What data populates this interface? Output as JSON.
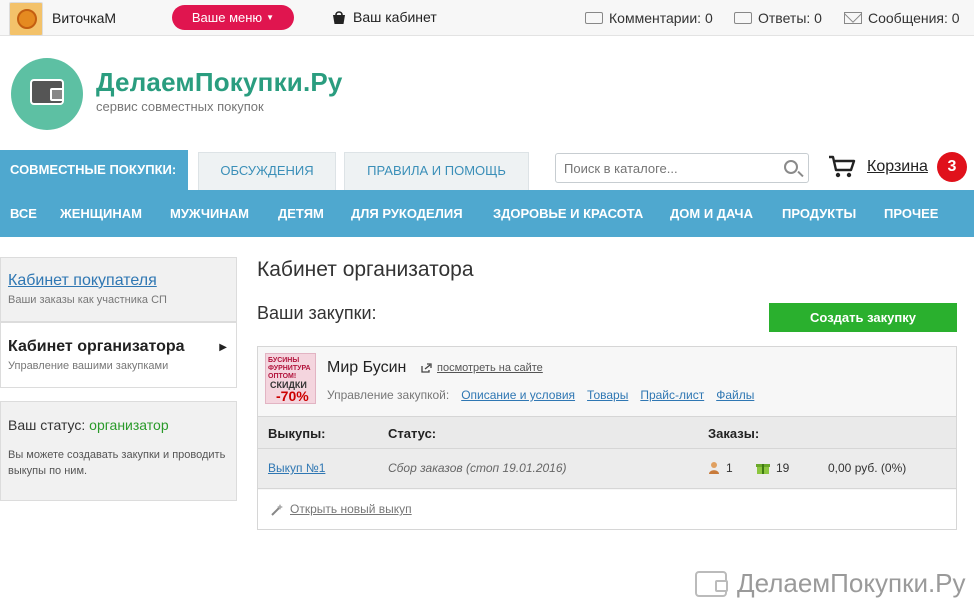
{
  "topbar": {
    "username": "ВиточкаМ",
    "menu_label": "Ваше меню",
    "cabinet_label": "Ваш кабинет",
    "comments": "Комментарии: 0",
    "answers": "Ответы: 0",
    "messages": "Сообщения: 0"
  },
  "header": {
    "site_name": "ДелаемПокупки.Ру",
    "tagline": "сервис совместных покупок"
  },
  "tabs": {
    "main": "СОВМЕСТНЫЕ ПОКУПКИ:",
    "discussions": "ОБСУЖДЕНИЯ",
    "rules": "ПРАВИЛА И ПОМОЩЬ"
  },
  "search": {
    "placeholder": "Поиск в каталоге..."
  },
  "cart": {
    "label": "Корзина",
    "count": "3"
  },
  "categories": [
    "ВСЕ",
    "ЖЕНЩИНАМ",
    "МУЖЧИНАМ",
    "ДЕТЯМ",
    "ДЛЯ РУКОДЕЛИЯ",
    "ЗДОРОВЬЕ И КРАСОТА",
    "ДОМ И ДАЧА",
    "ПРОДУКТЫ",
    "ПРОЧЕЕ"
  ],
  "sidebar": {
    "buyer_title": "Кабинет покупателя",
    "buyer_sub": "Ваши заказы как участника СП",
    "organizer_title": "Кабинет организатора",
    "organizer_sub": "Управление вашими закупками",
    "status_label": "Ваш статус:",
    "status_value": "организатор",
    "status_text": "Вы можете создавать закупки и проводить выкупы по ним."
  },
  "main": {
    "title": "Кабинет организатора",
    "subtitle": "Ваши закупки:",
    "create_button": "Создать закупку"
  },
  "purchase": {
    "image_text_top": "БУСИНЫ ФУРНИТУРА ОПТОМ!",
    "image_text_mid": "СКИДКИ",
    "image_text_big": "-70%",
    "name": "Мир Бусин",
    "site_link": "посмотреть на сайте",
    "mgmt_label": "Управление закупкой:",
    "mgmt_links": [
      "Описание и условия",
      "Товары",
      "Прайс-лист",
      "Файлы"
    ],
    "table_headers": {
      "buyouts": "Выкупы:",
      "status": "Статус:",
      "orders": "Заказы:"
    },
    "rows": [
      {
        "buyout": "Выкуп №1",
        "status": "Сбор заказов (стоп 19.01.2016)",
        "people": "1",
        "gifts": "19",
        "sum": "0,00 руб. (0%)"
      }
    ],
    "open_new": "Открыть новый выкуп"
  },
  "footer": {
    "logo_text": "ДелаемПокупки.Ру"
  }
}
